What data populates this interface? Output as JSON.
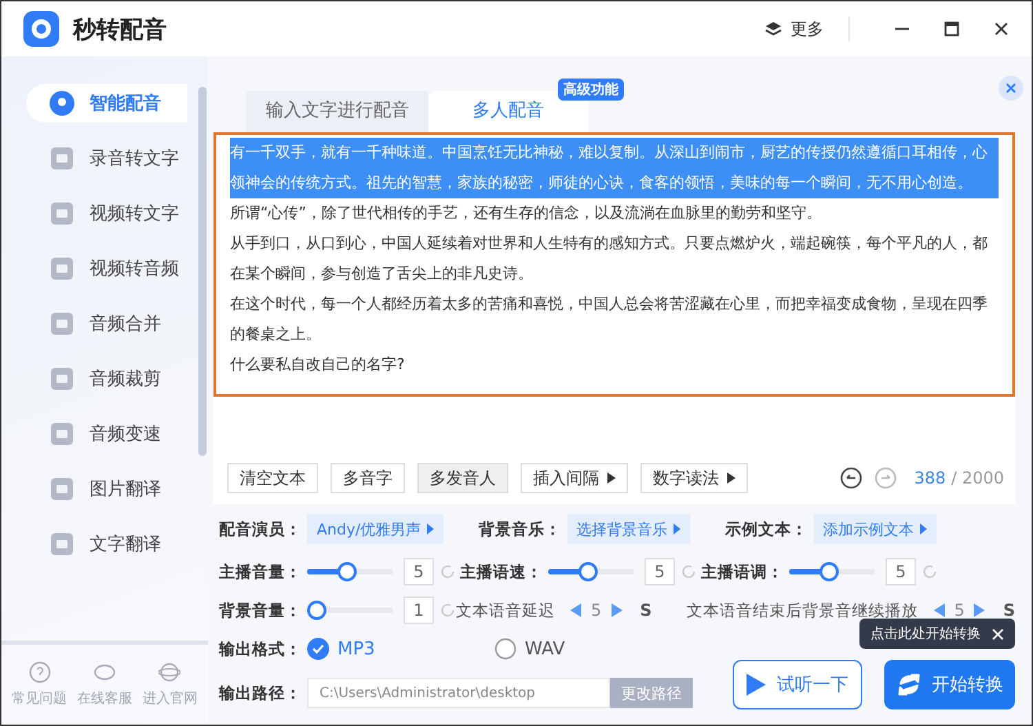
{
  "window": {
    "title": "秒转配音",
    "more": "更多"
  },
  "sidebar": {
    "items": [
      {
        "label": "智能配音",
        "selected": true
      },
      {
        "label": "录音转文字",
        "selected": false
      },
      {
        "label": "视频转文字",
        "selected": false
      },
      {
        "label": "视频转音频",
        "selected": false
      },
      {
        "label": "音频合并",
        "selected": false
      },
      {
        "label": "音频裁剪",
        "selected": false
      },
      {
        "label": "音频变速",
        "selected": false
      },
      {
        "label": "图片翻译",
        "selected": false
      },
      {
        "label": "文字翻译",
        "selected": false
      }
    ],
    "footer": [
      {
        "label": "常见问题"
      },
      {
        "label": "在线客服"
      },
      {
        "label": "进入官网"
      }
    ]
  },
  "tabs": [
    {
      "label": "输入文字进行配音",
      "selected": false
    },
    {
      "label": "多人配音",
      "selected": true
    }
  ],
  "badge": "高级功能",
  "editor": {
    "paragraphs": [
      {
        "text": "有一千双手，就有一千种味道。中国烹饪无比神秘，难以复制。从深山到闹市，厨艺的传授仍然遵循口耳相传，心领神会的传统方式。祖先的智慧，家族的秘密，师徒的心诀，食客的领悟，美味的每一个瞬间，无不用心创造。",
        "selected": true
      },
      {
        "text": "所谓“心传”，除了世代相传的手艺，还有生存的信念，以及流淌在血脉里的勤劳和坚守。",
        "selected": false
      },
      {
        "text": "从手到口，从口到心，中国人延续着对世界和人生特有的感知方式。只要点燃炉火，端起碗筷，每个平凡的人，都在某个瞬间，参与创造了舌尖上的非凡史诗。",
        "selected": false
      },
      {
        "text": "在这个时代，每一个人都经历着太多的苦痛和喜悦，中国人总会将苦涩藏在心里，而把幸福变成食物，呈现在四季的餐桌之上。",
        "selected": false
      },
      {
        "text": "什么要私自改自己的名字?",
        "selected": false
      }
    ],
    "tools": [
      {
        "label": "清空文本",
        "kind": "plain",
        "selected": false
      },
      {
        "label": "多音字",
        "kind": "plain",
        "selected": false
      },
      {
        "label": "多发音人",
        "kind": "plain",
        "selected": true
      },
      {
        "label": "插入间隔",
        "kind": "menu",
        "selected": false
      },
      {
        "label": "数字读法",
        "kind": "menu",
        "selected": false
      }
    ],
    "count": "388",
    "limit": "/ 2000"
  },
  "voice_row": [
    {
      "label": "配音演员：",
      "value": "Andy/优雅男声"
    },
    {
      "label": "背景音乐：",
      "value": "选择背景音乐"
    },
    {
      "label": "示例文本：",
      "value": "添加示例文本"
    }
  ],
  "sliders": [
    {
      "label": "主播音量：",
      "level": 0.45,
      "value": "5"
    },
    {
      "label": "主播语速：",
      "level": 0.45,
      "value": "5"
    },
    {
      "label": "主播语调：",
      "level": 0.45,
      "value": "5"
    }
  ],
  "bg_row": {
    "slider": {
      "label": "背景音量：",
      "level": 0,
      "value": "1"
    },
    "delays": [
      {
        "label": "文本语音延迟",
        "value": "5",
        "unit": "S"
      },
      {
        "label": "文本语音结束后背景音继续播放",
        "value": "5",
        "unit": "S"
      }
    ]
  },
  "output_format": {
    "label": "输出格式：",
    "options": [
      {
        "label": "MP3",
        "selected": true
      },
      {
        "label": "WAV",
        "selected": false
      }
    ]
  },
  "output_path": {
    "label": "输出路径：",
    "value": "C:\\Users\\Administrator\\desktop",
    "button": "更改路径"
  },
  "actions": [
    {
      "label": "试听一下",
      "kind": "preview"
    },
    {
      "label": "开始转换",
      "kind": "convert"
    }
  ],
  "tooltip": "点击此处开始转换"
}
